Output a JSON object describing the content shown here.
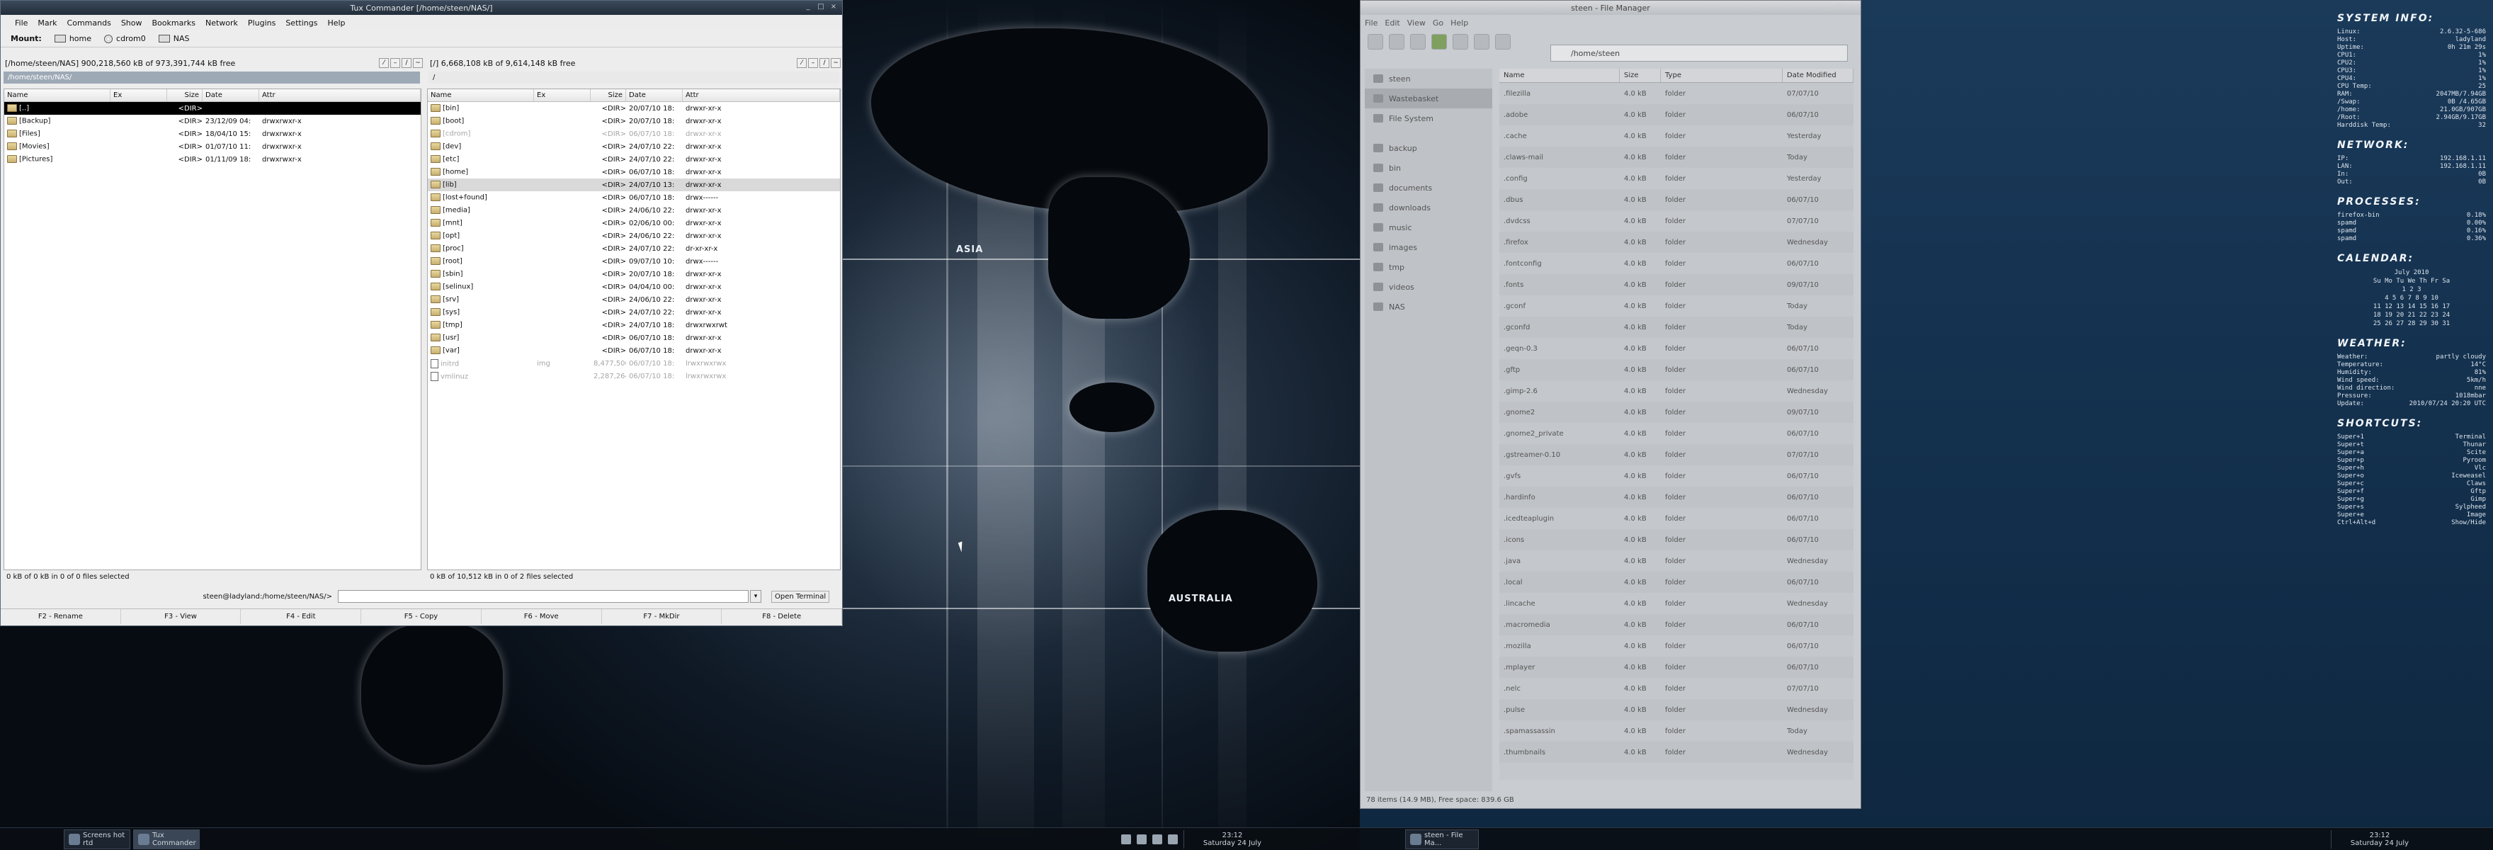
{
  "tux": {
    "title": "Tux Commander  [/home/steen/NAS/]",
    "menu": [
      "File",
      "Mark",
      "Commands",
      "Show",
      "Bookmarks",
      "Network",
      "Plugins",
      "Settings",
      "Help"
    ],
    "mount_label": "Mount:",
    "mounts": [
      "home",
      "cdrom0",
      "NAS"
    ],
    "left": {
      "free": "[/home/steen/NAS] 900,218,560 kB of 973,391,744 kB free",
      "path": "/home/steen/NAS/",
      "headers": [
        "Name",
        "Ex",
        "Size",
        "Date",
        "Attr"
      ],
      "rows": [
        {
          "name": "[..]",
          "ex": "",
          "size": "<DIR>",
          "date": "",
          "attr": ""
        },
        {
          "name": "[Backup]",
          "ex": "",
          "size": "<DIR>",
          "date": "23/12/09 04:",
          "attr": "drwxrwxr-x"
        },
        {
          "name": "[Files]",
          "ex": "",
          "size": "<DIR>",
          "date": "18/04/10 15:",
          "attr": "drwxrwxr-x"
        },
        {
          "name": "[Movies]",
          "ex": "",
          "size": "<DIR>",
          "date": "01/07/10 11:",
          "attr": "drwxrwxr-x"
        },
        {
          "name": "[Pictures]",
          "ex": "",
          "size": "<DIR>",
          "date": "01/11/09 18:",
          "attr": "drwxrwxr-x"
        }
      ],
      "status": "0 kB of 0 kB in 0 of 0 files selected"
    },
    "right": {
      "free": "[/] 6,668,108 kB of 9,614,148 kB free",
      "path": "/",
      "headers": [
        "Name",
        "Ex",
        "Size",
        "Date",
        "Attr"
      ],
      "rows": [
        {
          "name": "[bin]",
          "ex": "",
          "size": "<DIR>",
          "date": "20/07/10 18:",
          "attr": "drwxr-xr-x",
          "kind": "dir"
        },
        {
          "name": "[boot]",
          "ex": "",
          "size": "<DIR>",
          "date": "20/07/10 18:",
          "attr": "drwxr-xr-x",
          "kind": "dir"
        },
        {
          "name": "[cdrom]",
          "ex": "",
          "size": "<DIR>",
          "date": "06/07/10 18:",
          "attr": "drwxr-xr-x",
          "kind": "dim"
        },
        {
          "name": "[dev]",
          "ex": "",
          "size": "<DIR>",
          "date": "24/07/10 22:",
          "attr": "drwxr-xr-x",
          "kind": "dir"
        },
        {
          "name": "[etc]",
          "ex": "",
          "size": "<DIR>",
          "date": "24/07/10 22:",
          "attr": "drwxr-xr-x",
          "kind": "dir"
        },
        {
          "name": "[home]",
          "ex": "",
          "size": "<DIR>",
          "date": "06/07/10 18:",
          "attr": "drwxr-xr-x",
          "kind": "dir"
        },
        {
          "name": "[lib]",
          "ex": "",
          "size": "<DIR>",
          "date": "24/07/10 13:",
          "attr": "drwxr-xr-x",
          "kind": "hl"
        },
        {
          "name": "[lost+found]",
          "ex": "",
          "size": "<DIR>",
          "date": "06/07/10 18:",
          "attr": "drwx------",
          "kind": "dir"
        },
        {
          "name": "[media]",
          "ex": "",
          "size": "<DIR>",
          "date": "24/06/10 22:",
          "attr": "drwxr-xr-x",
          "kind": "dir"
        },
        {
          "name": "[mnt]",
          "ex": "",
          "size": "<DIR>",
          "date": "02/06/10 00:",
          "attr": "drwxr-xr-x",
          "kind": "dir"
        },
        {
          "name": "[opt]",
          "ex": "",
          "size": "<DIR>",
          "date": "24/06/10 22:",
          "attr": "drwxr-xr-x",
          "kind": "dir"
        },
        {
          "name": "[proc]",
          "ex": "",
          "size": "<DIR>",
          "date": "24/07/10 22:",
          "attr": "dr-xr-xr-x",
          "kind": "dir"
        },
        {
          "name": "[root]",
          "ex": "",
          "size": "<DIR>",
          "date": "09/07/10 10:",
          "attr": "drwx------",
          "kind": "dir"
        },
        {
          "name": "[sbin]",
          "ex": "",
          "size": "<DIR>",
          "date": "20/07/10 18:",
          "attr": "drwxr-xr-x",
          "kind": "dir"
        },
        {
          "name": "[selinux]",
          "ex": "",
          "size": "<DIR>",
          "date": "04/04/10 00:",
          "attr": "drwxr-xr-x",
          "kind": "dir"
        },
        {
          "name": "[srv]",
          "ex": "",
          "size": "<DIR>",
          "date": "24/06/10 22:",
          "attr": "drwxr-xr-x",
          "kind": "dir"
        },
        {
          "name": "[sys]",
          "ex": "",
          "size": "<DIR>",
          "date": "24/07/10 22:",
          "attr": "drwxr-xr-x",
          "kind": "dir"
        },
        {
          "name": "[tmp]",
          "ex": "",
          "size": "<DIR>",
          "date": "24/07/10 18:",
          "attr": "drwxrwxrwt",
          "kind": "dir"
        },
        {
          "name": "[usr]",
          "ex": "",
          "size": "<DIR>",
          "date": "06/07/10 18:",
          "attr": "drwxr-xr-x",
          "kind": "dir"
        },
        {
          "name": "[var]",
          "ex": "",
          "size": "<DIR>",
          "date": "06/07/10 18:",
          "attr": "drwxr-xr-x",
          "kind": "dir"
        },
        {
          "name": "initrd",
          "ex": "img",
          "size": "8,477,506",
          "date": "06/07/10 18:",
          "attr": "lrwxrwxrwx",
          "kind": "file"
        },
        {
          "name": "vmlinuz",
          "ex": "",
          "size": "2,287,264",
          "date": "06/07/10 18:",
          "attr": "lrwxrwxrwx",
          "kind": "file"
        }
      ],
      "status": "0 kB of 10,512 kB in 0 of 2 files selected"
    },
    "cmd_prompt": "steen@ladyland:/home/steen/NAS/>",
    "open_terminal": "Open Terminal",
    "fkeys": [
      "F2 - Rename",
      "F3 - View",
      "F4 - Edit",
      "F5 - Copy",
      "F6 - Move",
      "F7 - MkDir",
      "F8 - Delete"
    ]
  },
  "map": {
    "asia": "ASIA",
    "australia": "AUSTRALIA"
  },
  "fm": {
    "title": "steen - File Manager",
    "menu": [
      "File",
      "Edit",
      "View",
      "Go",
      "Help"
    ],
    "location": "/home/steen",
    "sidebar": [
      "steen",
      "Wastebasket",
      "File System",
      "backup",
      "bin",
      "documents",
      "downloads",
      "music",
      "images",
      "tmp",
      "videos",
      "NAS"
    ],
    "headers": [
      "Name",
      "Size",
      "Type",
      "Date Modified"
    ],
    "rows": [
      {
        "name": ".filezilla",
        "size": "4.0 kB",
        "type": "folder",
        "date": "07/07/10"
      },
      {
        "name": ".adobe",
        "size": "4.0 kB",
        "type": "folder",
        "date": "06/07/10"
      },
      {
        "name": ".cache",
        "size": "4.0 kB",
        "type": "folder",
        "date": "Yesterday"
      },
      {
        "name": ".claws-mail",
        "size": "4.0 kB",
        "type": "folder",
        "date": "Today"
      },
      {
        "name": ".config",
        "size": "4.0 kB",
        "type": "folder",
        "date": "Yesterday"
      },
      {
        "name": ".dbus",
        "size": "4.0 kB",
        "type": "folder",
        "date": "06/07/10"
      },
      {
        "name": ".dvdcss",
        "size": "4.0 kB",
        "type": "folder",
        "date": "07/07/10"
      },
      {
        "name": ".firefox",
        "size": "4.0 kB",
        "type": "folder",
        "date": "Wednesday"
      },
      {
        "name": ".fontconfig",
        "size": "4.0 kB",
        "type": "folder",
        "date": "06/07/10"
      },
      {
        "name": ".fonts",
        "size": "4.0 kB",
        "type": "folder",
        "date": "09/07/10"
      },
      {
        "name": ".gconf",
        "size": "4.0 kB",
        "type": "folder",
        "date": "Today"
      },
      {
        "name": ".gconfd",
        "size": "4.0 kB",
        "type": "folder",
        "date": "Today"
      },
      {
        "name": ".geqn-0.3",
        "size": "4.0 kB",
        "type": "folder",
        "date": "06/07/10"
      },
      {
        "name": ".gftp",
        "size": "4.0 kB",
        "type": "folder",
        "date": "06/07/10"
      },
      {
        "name": ".gimp-2.6",
        "size": "4.0 kB",
        "type": "folder",
        "date": "Wednesday"
      },
      {
        "name": ".gnome2",
        "size": "4.0 kB",
        "type": "folder",
        "date": "09/07/10"
      },
      {
        "name": ".gnome2_private",
        "size": "4.0 kB",
        "type": "folder",
        "date": "06/07/10"
      },
      {
        "name": ".gstreamer-0.10",
        "size": "4.0 kB",
        "type": "folder",
        "date": "07/07/10"
      },
      {
        "name": ".gvfs",
        "size": "4.0 kB",
        "type": "folder",
        "date": "06/07/10"
      },
      {
        "name": ".hardinfo",
        "size": "4.0 kB",
        "type": "folder",
        "date": "06/07/10"
      },
      {
        "name": ".icedteaplugin",
        "size": "4.0 kB",
        "type": "folder",
        "date": "06/07/10"
      },
      {
        "name": ".icons",
        "size": "4.0 kB",
        "type": "folder",
        "date": "06/07/10"
      },
      {
        "name": ".java",
        "size": "4.0 kB",
        "type": "folder",
        "date": "Wednesday"
      },
      {
        "name": ".local",
        "size": "4.0 kB",
        "type": "folder",
        "date": "06/07/10"
      },
      {
        "name": ".lincache",
        "size": "4.0 kB",
        "type": "folder",
        "date": "Wednesday"
      },
      {
        "name": ".macromedia",
        "size": "4.0 kB",
        "type": "folder",
        "date": "06/07/10"
      },
      {
        "name": ".mozilla",
        "size": "4.0 kB",
        "type": "folder",
        "date": "06/07/10"
      },
      {
        "name": ".mplayer",
        "size": "4.0 kB",
        "type": "folder",
        "date": "06/07/10"
      },
      {
        "name": ".nelc",
        "size": "4.0 kB",
        "type": "folder",
        "date": "07/07/10"
      },
      {
        "name": ".pulse",
        "size": "4.0 kB",
        "type": "folder",
        "date": "Wednesday"
      },
      {
        "name": ".spamassassin",
        "size": "4.0 kB",
        "type": "folder",
        "date": "Today"
      },
      {
        "name": ".thumbnails",
        "size": "4.0 kB",
        "type": "folder",
        "date": "Wednesday"
      }
    ],
    "status": "78 items (14.9 MB), Free space: 839.6 GB"
  },
  "conky": {
    "system_title": "SYSTEM INFO:",
    "system": [
      [
        "Linux:",
        "2.6.32-5-686"
      ],
      [
        "Host:",
        "ladyland"
      ],
      [
        "Uptime:",
        "0h 21m 29s"
      ],
      [
        "CPU1:",
        "1%"
      ],
      [
        "CPU2:",
        "1%"
      ],
      [
        "CPU3:",
        "1%"
      ],
      [
        "CPU4:",
        "1%"
      ],
      [
        "CPU Temp:",
        "25"
      ],
      [
        "RAM:",
        "2047MB/7.94GB"
      ],
      [
        "/Swap:",
        "0B /4.65GB"
      ],
      [
        "/home:",
        "21.0GB/907GB"
      ],
      [
        "/Root:",
        "2.94GB/9.17GB"
      ],
      [
        "Harddisk Temp:",
        "32"
      ]
    ],
    "network_title": "NETWORK:",
    "network": [
      [
        "IP:",
        "192.168.1.11"
      ],
      [
        "LAN:",
        "192.168.1.11"
      ],
      [
        "In:",
        "0B"
      ],
      [
        "Out:",
        "0B"
      ]
    ],
    "processes_title": "PROCESSES:",
    "processes": [
      [
        "firefox-bin",
        "0.18%"
      ],
      [
        "spamd",
        "0.00%"
      ],
      [
        "spamd",
        "0.16%"
      ],
      [
        "spamd",
        "0.36%"
      ]
    ],
    "calendar_title": "CALENDAR:",
    "calendar": [
      "July 2010",
      "Su Mo Tu We Th Fr Sa",
      "1  2  3",
      "4  5  6  7  8  9 10",
      "11 12 13 14 15 16 17",
      "18 19 20 21 22 23 24",
      "25 26 27 28 29 30 31"
    ],
    "weather_title": "WEATHER:",
    "weather": [
      [
        "Weather:",
        "partly cloudy"
      ],
      [
        "Temperature:",
        "14°C"
      ],
      [
        "Humidity:",
        "81%"
      ],
      [
        "Wind speed:",
        "5km/h"
      ],
      [
        "Wind direction:",
        "nne"
      ],
      [
        "Pressure:",
        "1018mbar"
      ],
      [
        "Update:",
        "2010/07/24 20:20 UTC"
      ]
    ],
    "shortcuts_title": "SHORTCUTS:",
    "shortcuts": [
      [
        "Super+1",
        "Terminal"
      ],
      [
        "Super+t",
        "Thunar"
      ],
      [
        "Super+a",
        "Scite"
      ],
      [
        "Super+p",
        "Pyroom"
      ],
      [
        "Super+h",
        "Vlc"
      ],
      [
        "Super+o",
        "Iceweasel"
      ],
      [
        "Super+c",
        "Claws"
      ],
      [
        "Super+f",
        "Gftp"
      ],
      [
        "Super+g",
        "Gimp"
      ],
      [
        "Super+s",
        "Sylpheed"
      ],
      [
        "Super+e",
        "Image"
      ],
      [
        "Ctrl+Alt+d",
        "Show/Hide"
      ]
    ]
  },
  "taskbar_left": {
    "tasks": [
      "Screens hot rtd",
      "Tux Commander"
    ],
    "clock_time": "23:12",
    "clock_date": "Saturday 24 July"
  },
  "taskbar_right": {
    "tasks": [
      "steen - File Ma..."
    ],
    "clock_time": "23:12",
    "clock_date": "Saturday 24 July"
  }
}
